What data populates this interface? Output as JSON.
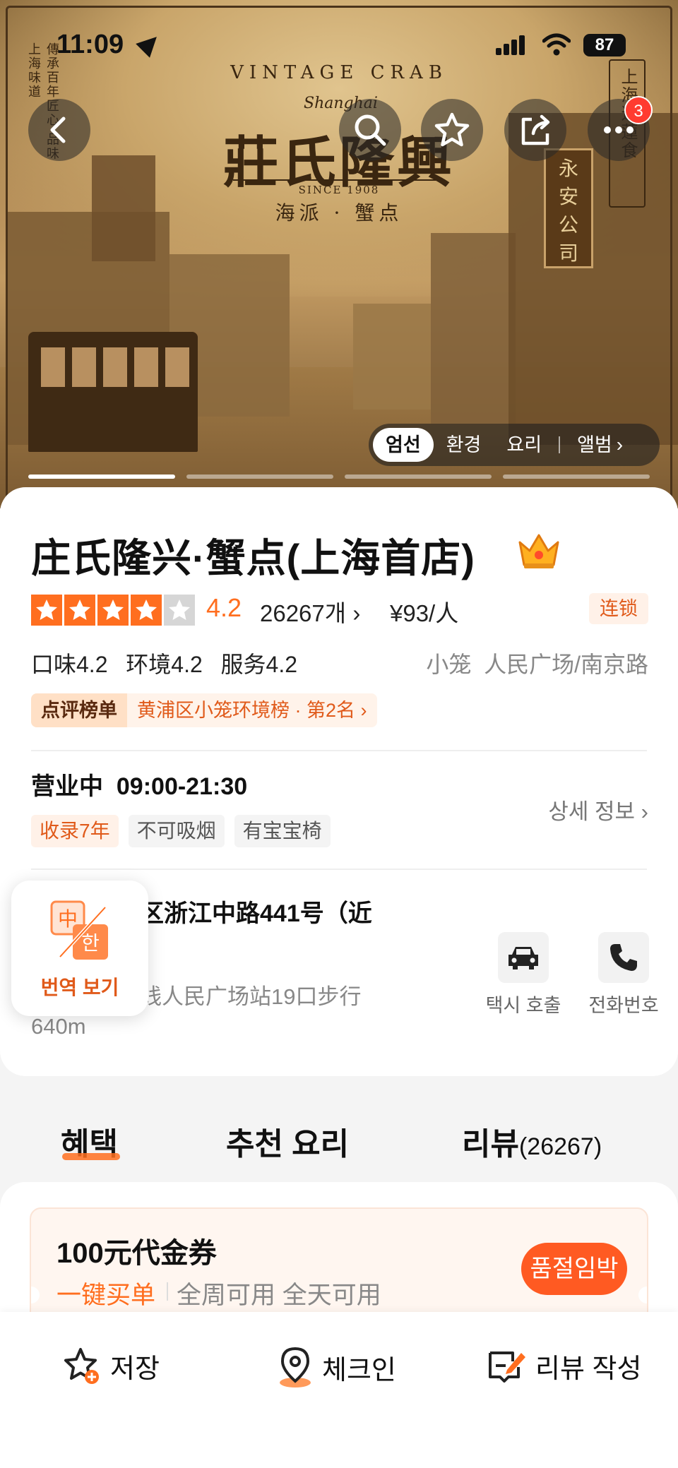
{
  "status_bar": {
    "time": "11:09",
    "battery": "87"
  },
  "hero": {
    "logo": {
      "arc_text": "VINTAGE CRAB",
      "script": "Shanghai",
      "title": "莊氏隆興",
      "since": "SINCE 1908",
      "subtitle": "海派 · 蟹点"
    },
    "left_scroll": "傳承百年匠心 品味上海味道",
    "right_scroll": "上海道蓮食",
    "signboard": [
      "永",
      "安",
      "公",
      "司"
    ],
    "more_badge": "3",
    "tabs": [
      {
        "label": "엄선",
        "active": true
      },
      {
        "label": "환경",
        "active": false
      },
      {
        "label": "요리",
        "active": false
      },
      {
        "label": "앨범",
        "active": false
      }
    ]
  },
  "store": {
    "name": "庄氏隆兴·蟹点(上海首店)",
    "rating_stars": 4.2,
    "score": "4.2",
    "review_count": "26267개",
    "price": "¥93/人",
    "chain_tag": "连锁",
    "subscores": "口味4.2  环境4.2  服务4.2",
    "areas": "小笼  人民广场/南京路",
    "rank_tag": "点评榜单",
    "rank_text": "黄浦区小笼环境榜 · 第2名",
    "hours": "营业中  09:00-21:30",
    "chips": [
      {
        "label": "收录7年",
        "highlight": true
      },
      {
        "label": "不可吸烟",
        "highlight": false
      },
      {
        "label": "有宝宝椅",
        "highlight": false
      }
    ],
    "detail_link": "상세 정보",
    "address": "区浙江中路441号（近",
    "transit": "线人民广场站19口步行",
    "walk": "640m",
    "actions": [
      {
        "label": "택시 호출",
        "icon": "car-icon"
      },
      {
        "label": "전화번호",
        "icon": "phone-icon"
      }
    ],
    "translate_label": "번역 보기"
  },
  "tabs": {
    "benefits": "혜택",
    "recommended": "추천 요리",
    "reviews": "리뷰",
    "reviews_count": "(26267)"
  },
  "coupon": {
    "title": "100元代金券",
    "one_click": "一键买单",
    "availability": "全周可用 全天可用",
    "sold_out": "품절임박"
  },
  "bottom_bar": {
    "save": "저장",
    "checkin": "체크인",
    "write_review": "리뷰 작성"
  },
  "colors": {
    "accent": "#ff6e1f",
    "accent_dark": "#e05a1a"
  }
}
